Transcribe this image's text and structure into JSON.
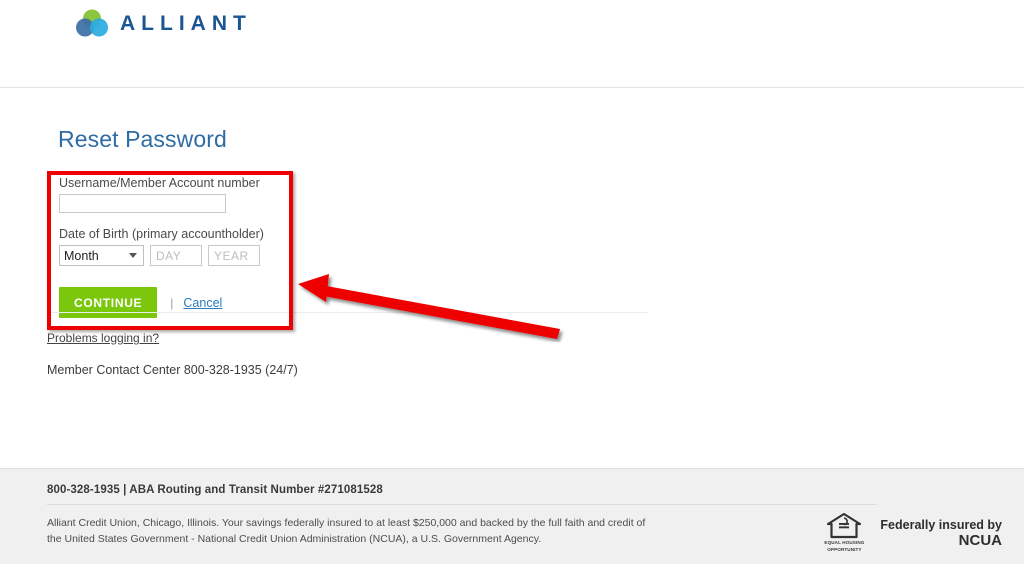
{
  "brand": {
    "name": "ALLIANT",
    "logo_colors": {
      "green": "#8cc63f",
      "dark_blue": "#3b6ea5",
      "light_blue": "#29abe2",
      "wordmark": "#1b5693"
    }
  },
  "page": {
    "title": "Reset Password",
    "title_color": "#2e6ca4"
  },
  "form": {
    "username_label": "Username/Member Account number",
    "username_value": "",
    "username_placeholder": "",
    "dob_label": "Date of Birth (primary accountholder)",
    "month_selected": "Month",
    "month_options": [
      "Month"
    ],
    "day_value": "",
    "day_placeholder": "DAY",
    "year_value": "",
    "year_placeholder": "YEAR",
    "continue_label": "CONTINUE",
    "separator": "|",
    "cancel_label": "Cancel",
    "continue_color": "#7ac70c"
  },
  "links": {
    "problems": "Problems logging in?",
    "contact": "Member Contact Center 800-328-1935 (24/7)"
  },
  "annotation": {
    "color": "#ee0000",
    "arrow_direction": "left",
    "highlights": "reset-password-form"
  },
  "footer": {
    "phone_line": "800-328-1935 | ABA Routing and Transit Number #271081528",
    "disclosure_line1": "Alliant Credit Union, Chicago, Illinois. Your savings federally insured to at least $250,000 and backed by the full faith and credit of",
    "disclosure_line2": "the United States Government - National Credit Union Administration (NCUA), a U.S. Government Agency.",
    "eho_caption_line1": "EQUAL HOUSING",
    "eho_caption_line2": "OPPORTUNITY",
    "ncua_line1": "Federally insured by",
    "ncua_line2": "NCUA"
  }
}
